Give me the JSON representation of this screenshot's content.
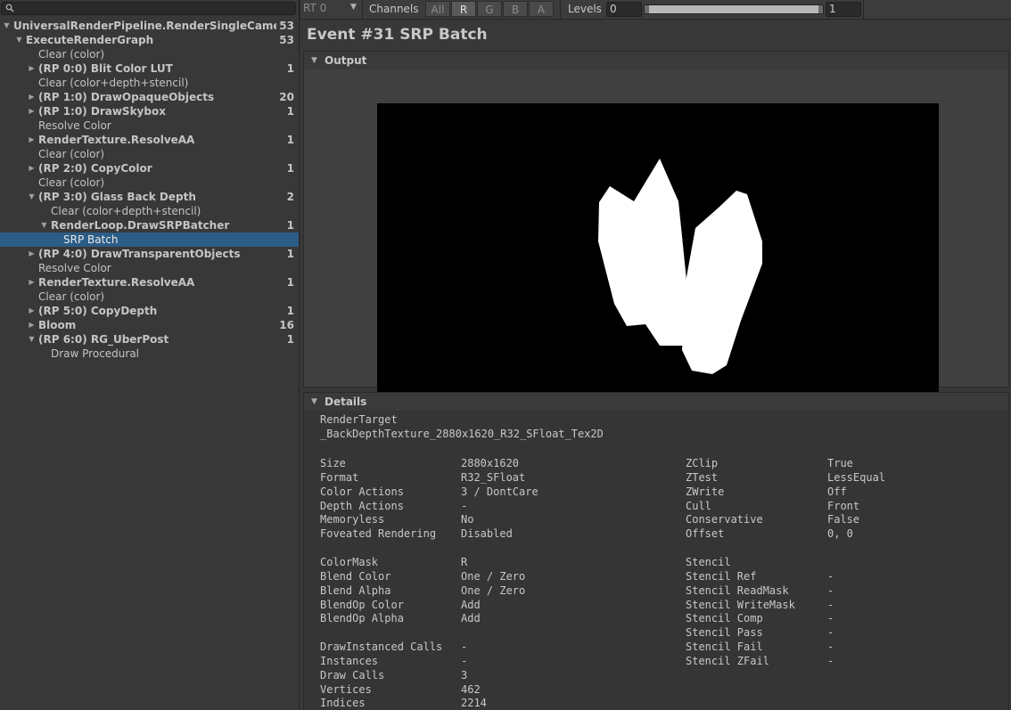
{
  "search": {
    "placeholder": ""
  },
  "tree": [
    {
      "label": "UniversalRenderPipeline.RenderSingleCameraInter",
      "count": "53",
      "depth": 0,
      "expanded": true,
      "bold": true,
      "has_children": true
    },
    {
      "label": "ExecuteRenderGraph",
      "count": "53",
      "depth": 1,
      "expanded": true,
      "bold": true,
      "has_children": true
    },
    {
      "label": "Clear (color)",
      "count": "",
      "depth": 2,
      "bold": false,
      "has_children": false
    },
    {
      "label": "(RP 0:0) Blit Color LUT",
      "count": "1",
      "depth": 2,
      "expanded": false,
      "bold": true,
      "has_children": true
    },
    {
      "label": "Clear (color+depth+stencil)",
      "count": "",
      "depth": 2,
      "bold": false,
      "has_children": false
    },
    {
      "label": "(RP 1:0) DrawOpaqueObjects",
      "count": "20",
      "depth": 2,
      "expanded": false,
      "bold": true,
      "has_children": true
    },
    {
      "label": "(RP 1:0) DrawSkybox",
      "count": "1",
      "depth": 2,
      "expanded": false,
      "bold": true,
      "has_children": true
    },
    {
      "label": "Resolve Color",
      "count": "",
      "depth": 2,
      "bold": false,
      "has_children": false
    },
    {
      "label": "RenderTexture.ResolveAA",
      "count": "1",
      "depth": 2,
      "expanded": false,
      "bold": true,
      "has_children": true
    },
    {
      "label": "Clear (color)",
      "count": "",
      "depth": 2,
      "bold": false,
      "has_children": false
    },
    {
      "label": "(RP 2:0) CopyColor",
      "count": "1",
      "depth": 2,
      "expanded": false,
      "bold": true,
      "has_children": true
    },
    {
      "label": "Clear (color)",
      "count": "",
      "depth": 2,
      "bold": false,
      "has_children": false
    },
    {
      "label": "(RP 3:0) Glass Back Depth",
      "count": "2",
      "depth": 2,
      "expanded": true,
      "bold": true,
      "has_children": true
    },
    {
      "label": "Clear (color+depth+stencil)",
      "count": "",
      "depth": 3,
      "bold": false,
      "has_children": false
    },
    {
      "label": "RenderLoop.DrawSRPBatcher",
      "count": "1",
      "depth": 3,
      "expanded": true,
      "bold": true,
      "has_children": true
    },
    {
      "label": "SRP Batch",
      "count": "",
      "depth": 4,
      "bold": false,
      "has_children": false,
      "selected": true
    },
    {
      "label": "(RP 4:0) DrawTransparentObjects",
      "count": "1",
      "depth": 2,
      "expanded": false,
      "bold": true,
      "has_children": true
    },
    {
      "label": "Resolve Color",
      "count": "",
      "depth": 2,
      "bold": false,
      "has_children": false
    },
    {
      "label": "RenderTexture.ResolveAA",
      "count": "1",
      "depth": 2,
      "expanded": false,
      "bold": true,
      "has_children": true
    },
    {
      "label": "Clear (color)",
      "count": "",
      "depth": 2,
      "bold": false,
      "has_children": false
    },
    {
      "label": "(RP 5:0) CopyDepth",
      "count": "1",
      "depth": 2,
      "expanded": false,
      "bold": true,
      "has_children": true
    },
    {
      "label": "Bloom",
      "count": "16",
      "depth": 2,
      "expanded": false,
      "bold": true,
      "has_children": true
    },
    {
      "label": "(RP 6:0) RG_UberPost",
      "count": "1",
      "depth": 2,
      "expanded": true,
      "bold": true,
      "has_children": true
    },
    {
      "label": "Draw Procedural",
      "count": "",
      "depth": 3,
      "bold": false,
      "has_children": false
    }
  ],
  "toolbar": {
    "rt_label": "RT 0",
    "channels_label": "Channels",
    "channels": [
      {
        "label": "All",
        "active": false
      },
      {
        "label": "R",
        "active": true
      },
      {
        "label": "G",
        "active": false
      },
      {
        "label": "B",
        "active": false
      },
      {
        "label": "A",
        "active": false
      }
    ],
    "levels_label": "Levels",
    "levels_min": "0",
    "levels_max": "1"
  },
  "event_title": "Event #31 SRP Batch",
  "output": {
    "header": "Output",
    "preview_background": "#000000",
    "shape_color": "#ffffff"
  },
  "details": {
    "header": "Details",
    "render_target_label": "RenderTarget",
    "render_target_name": "_BackDepthTexture_2880x1620_R32_SFloat_Tex2D",
    "left_rows": [
      {
        "label": "Size",
        "value": "2880x1620"
      },
      {
        "label": "Format",
        "value": "R32_SFloat"
      },
      {
        "label": "Color Actions",
        "value": "3 / DontCare"
      },
      {
        "label": "Depth Actions",
        "value": "-"
      },
      {
        "label": "Memoryless",
        "value": "No"
      },
      {
        "label": "Foveated Rendering",
        "value": "Disabled"
      },
      {
        "label": "",
        "value": ""
      },
      {
        "label": "ColorMask",
        "value": "R"
      },
      {
        "label": "Blend Color",
        "value": "One / Zero"
      },
      {
        "label": "Blend Alpha",
        "value": "One / Zero"
      },
      {
        "label": "BlendOp Color",
        "value": "Add"
      },
      {
        "label": "BlendOp Alpha",
        "value": "Add"
      },
      {
        "label": "",
        "value": ""
      },
      {
        "label": "DrawInstanced Calls",
        "value": "-"
      },
      {
        "label": "Instances",
        "value": "-"
      },
      {
        "label": "Draw Calls",
        "value": "3"
      },
      {
        "label": "Vertices",
        "value": "462"
      },
      {
        "label": "Indices",
        "value": "2214"
      }
    ],
    "right_rows": [
      {
        "label": "ZClip",
        "value": "True"
      },
      {
        "label": "ZTest",
        "value": "LessEqual"
      },
      {
        "label": "ZWrite",
        "value": "Off"
      },
      {
        "label": "Cull",
        "value": "Front"
      },
      {
        "label": "Conservative",
        "value": "False"
      },
      {
        "label": "Offset",
        "value": "0, 0"
      },
      {
        "label": "",
        "value": ""
      },
      {
        "label": "Stencil",
        "value": ""
      },
      {
        "label": "Stencil Ref",
        "value": "-"
      },
      {
        "label": "Stencil ReadMask",
        "value": "-"
      },
      {
        "label": "Stencil WriteMask",
        "value": "-"
      },
      {
        "label": "Stencil Comp",
        "value": "-"
      },
      {
        "label": "Stencil Pass",
        "value": "-"
      },
      {
        "label": "Stencil Fail",
        "value": "-"
      },
      {
        "label": "Stencil ZFail",
        "value": "-"
      }
    ]
  }
}
